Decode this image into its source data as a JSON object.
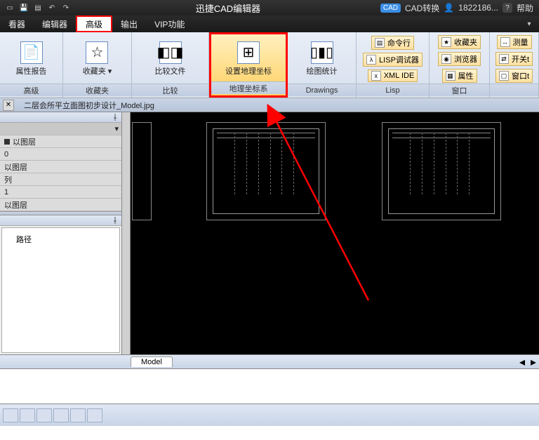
{
  "title": "迅捷CAD编辑器",
  "title_right": {
    "cad_convert": "CAD转换",
    "user": "1822186...",
    "help": "帮助"
  },
  "menu": {
    "viewer": "看器",
    "editor": "编辑器",
    "advanced": "高级",
    "output": "输出",
    "vip": "VIP功能"
  },
  "ribbon": {
    "prop": {
      "label": "属性报告",
      "group": "高级"
    },
    "fav": {
      "label": "收藏夹",
      "group": "收藏夹"
    },
    "cmp": {
      "label": "比较文件",
      "group": "比较"
    },
    "geo": {
      "label": "设置地理坐标",
      "group": "地理坐标系"
    },
    "drw": {
      "label": "绘图统计",
      "group": "Drawings"
    },
    "lisp": {
      "cmd": "命令行",
      "dbg": "LISP调试器",
      "ide": "XML IDE",
      "group": "Lisp"
    },
    "win": {
      "fav": "收藏夹",
      "brw": "浏览器",
      "prp": "属性",
      "group": "窗口"
    },
    "extra": {
      "measure": "测量",
      "open": "开关t",
      "win2": "窗口t"
    }
  },
  "file_tab": "二层会所平立面图初步设计_Model.jpg",
  "panel": {
    "by_layer1": "以图层",
    "zero": "0",
    "by_layer2": "以图层",
    "row4": "列",
    "one": "1",
    "by_layer3": "以图层",
    "path": "路径"
  },
  "model_tab": "Model"
}
